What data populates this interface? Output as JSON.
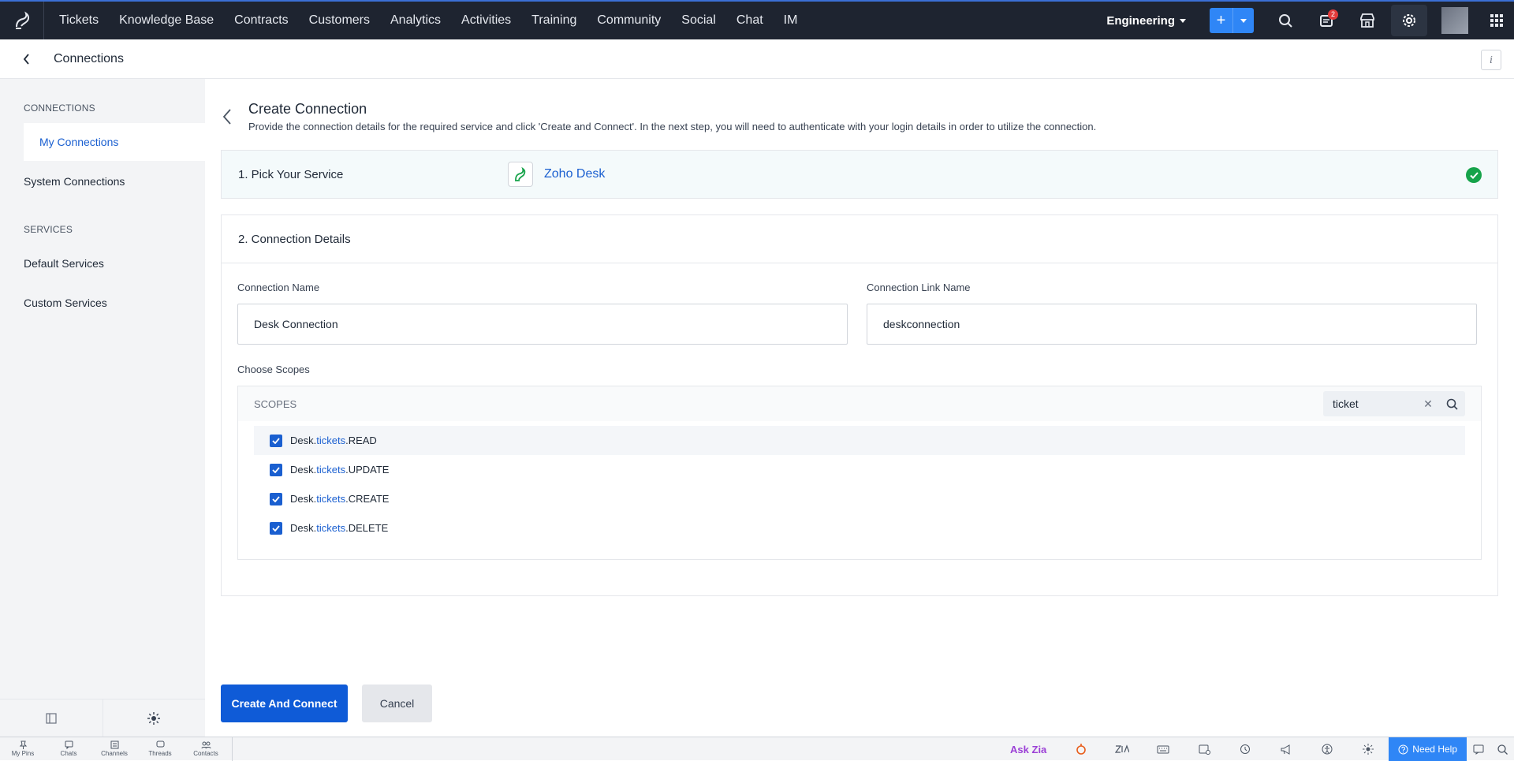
{
  "topnav": {
    "items": [
      "Tickets",
      "Knowledge Base",
      "Contracts",
      "Customers",
      "Analytics",
      "Activities",
      "Training",
      "Community",
      "Social",
      "Chat",
      "IM"
    ],
    "department": "Engineering",
    "notification_count": "2"
  },
  "subheader": {
    "title": "Connections",
    "info": "i"
  },
  "sidebar": {
    "connections_heading": "CONNECTIONS",
    "my_connections": "My Connections",
    "system_connections": "System Connections",
    "services_heading": "SERVICES",
    "default_services": "Default Services",
    "custom_services": "Custom Services"
  },
  "create": {
    "title": "Create Connection",
    "description": "Provide the connection details for the required service and click 'Create and Connect'. In the next step, you will need to authenticate with your login details in order to utilize the connection."
  },
  "step1": {
    "label": "1. Pick Your Service",
    "service": "Zoho Desk"
  },
  "step2": {
    "label": "2. Connection Details",
    "name_label": "Connection Name",
    "name_value": "Desk Connection",
    "link_label": "Connection Link Name",
    "link_value": "deskconnection",
    "scopes_label": "Choose Scopes",
    "scopes_heading": "SCOPES",
    "search_value": "ticket",
    "scopes": [
      {
        "prefix": "Desk.",
        "match": "tickets",
        "suffix": ".READ"
      },
      {
        "prefix": "Desk.",
        "match": "tickets",
        "suffix": ".UPDATE"
      },
      {
        "prefix": "Desk.",
        "match": "tickets",
        "suffix": ".CREATE"
      },
      {
        "prefix": "Desk.",
        "match": "tickets",
        "suffix": ".DELETE"
      }
    ]
  },
  "buttons": {
    "create": "Create And Connect",
    "cancel": "Cancel"
  },
  "bottombar": {
    "items": [
      "My Pins",
      "Chats",
      "Channels",
      "Threads",
      "Contacts"
    ],
    "ask_zia": "Ask Zia",
    "need_help": "Need Help"
  },
  "colors": {
    "accent": "#0f5bd7",
    "nav_bg": "#1e2430",
    "success": "#16a34a"
  }
}
